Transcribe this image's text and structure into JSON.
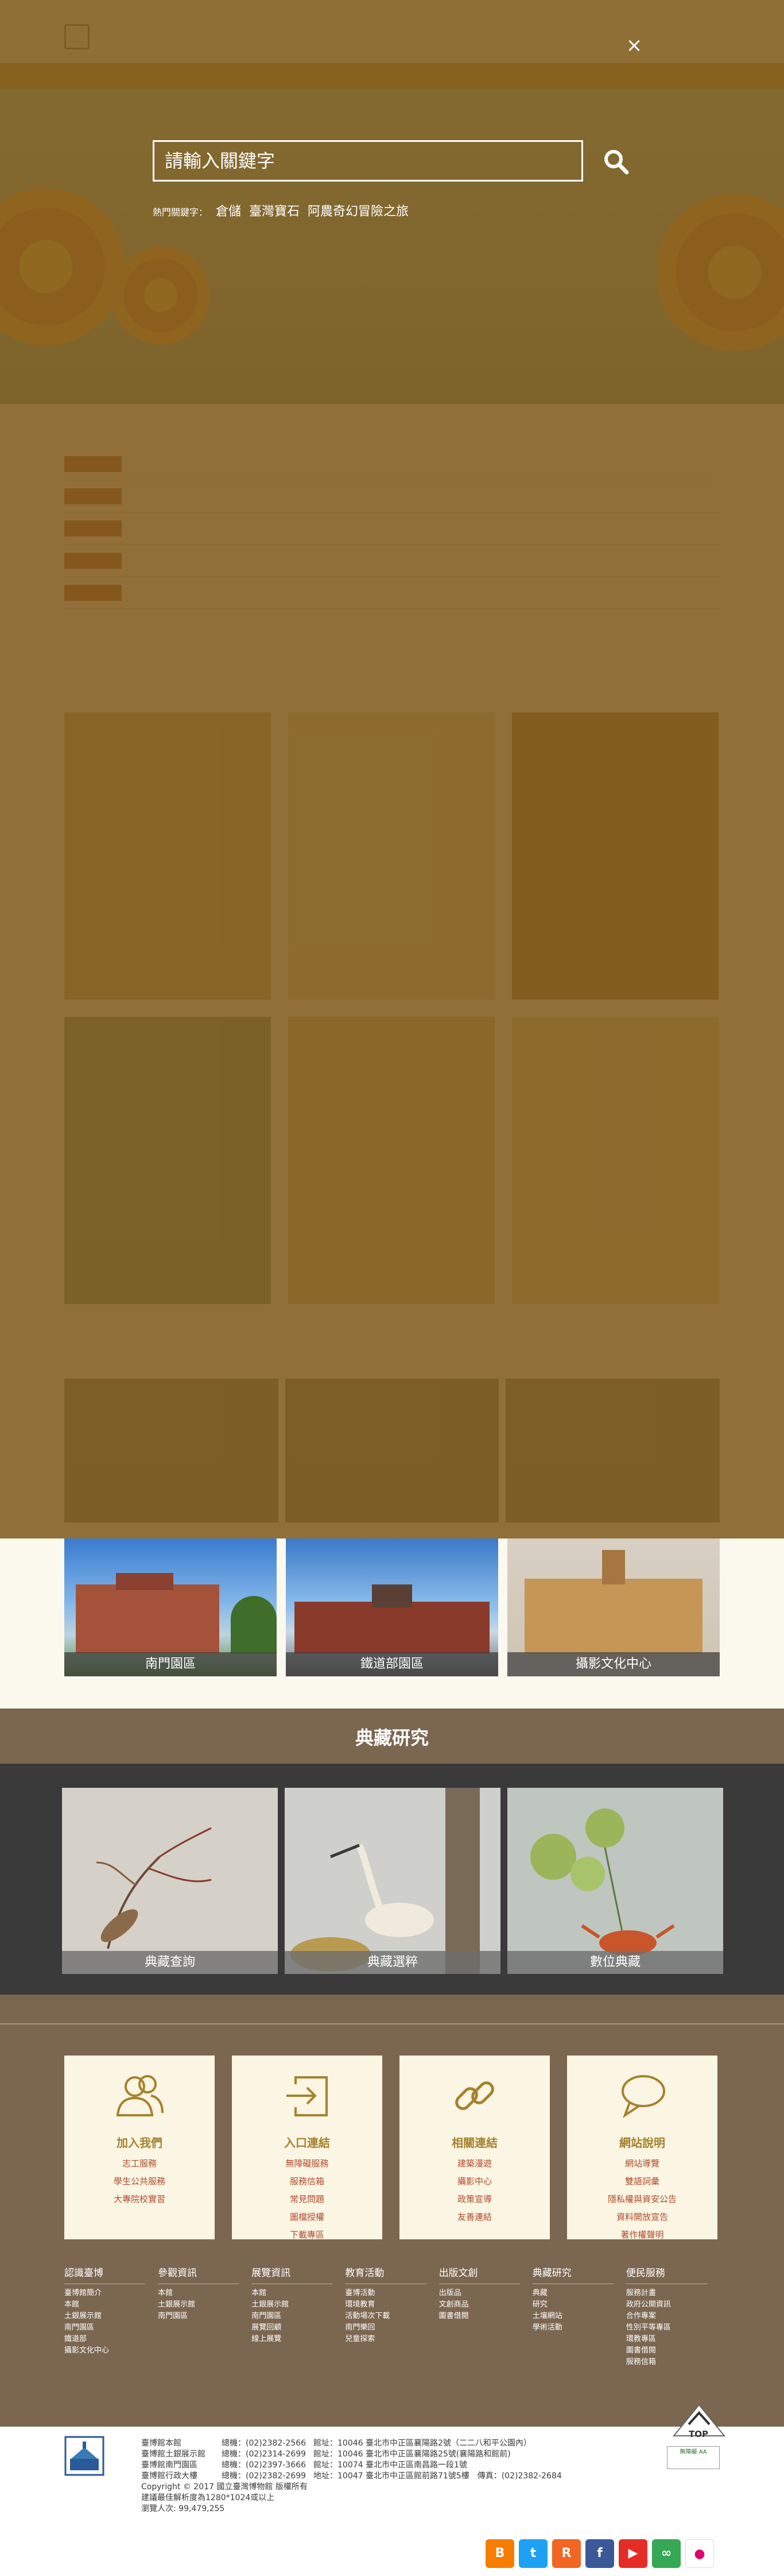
{
  "search": {
    "placeholder": "請輸入關鍵字",
    "hot_label": "熱門關鍵字：",
    "keywords": [
      "倉儲",
      "臺灣寶石",
      "阿農奇幻冒險之旅"
    ],
    "close_symbol": "×"
  },
  "venues": [
    {
      "label": "南門園區"
    },
    {
      "label": "鐵道部園區"
    },
    {
      "label": "攝影文化中心"
    }
  ],
  "collection": {
    "title": "典藏研究",
    "items": [
      {
        "label": "典藏查詢"
      },
      {
        "label": "典藏選粹"
      },
      {
        "label": "數位典藏"
      }
    ]
  },
  "info_boxes": [
    {
      "icon": "people-icon",
      "title": "加入我們",
      "links": [
        "志工服務",
        "學生公共服務",
        "大專院校實習"
      ]
    },
    {
      "icon": "enter-icon",
      "title": "入口連結",
      "links": [
        "無障礙服務",
        "服務信箱",
        "常見問題",
        "圖檔授權",
        "下載專區"
      ]
    },
    {
      "icon": "link-icon",
      "title": "相關連結",
      "links": [
        "建築漫遊",
        "攝影中心",
        "政策宣導",
        "友善連結"
      ]
    },
    {
      "icon": "chat-icon",
      "title": "網站說明",
      "links": [
        "網站導覽",
        "雙語詞彙",
        "隱私權與資安公告",
        "資料開放宣告",
        "著作權聲明"
      ]
    }
  ],
  "sitemap": [
    {
      "head": "認識臺博",
      "items": [
        "臺博館簡介",
        "本館",
        "土銀展示館",
        "南門園區",
        "鐵道部",
        "攝影文化中心"
      ]
    },
    {
      "head": "參觀資訊",
      "items": [
        "本館",
        "土銀展示館",
        "南門園區"
      ]
    },
    {
      "head": "展覽資訊",
      "items": [
        "本館",
        "土銀展示館",
        "南門園區",
        "展覽回顧",
        "線上展覽"
      ]
    },
    {
      "head": "教育活動",
      "items": [
        "臺博活動",
        "環境教育",
        "活動場次下載",
        "南門樂回",
        "兒童探索"
      ]
    },
    {
      "head": "出版文創",
      "items": [
        "出版品",
        "文創商品",
        "圖書借閱"
      ]
    },
    {
      "head": "典藏研究",
      "items": [
        "典藏",
        "研究",
        "土壤網站",
        "學術活動"
      ]
    },
    {
      "head": "便民服務",
      "items": [
        "服務計畫",
        "政府公開資訊",
        "合作專案",
        "性別平等專區",
        "環教專區",
        "圖書借閱",
        "服務信箱"
      ]
    }
  ],
  "footer": {
    "addresses": [
      {
        "name": "臺博館本館",
        "tel": "總機：(02)2382-2566",
        "addr": "館址：10046 臺北市中正區襄陽路2號（二二八和平公園內）"
      },
      {
        "name": "臺博館土銀展示館",
        "tel": "總機：(02)2314-2699",
        "addr": "館址：10046 臺北市中正區襄陽路25號(襄陽路和館前)"
      },
      {
        "name": "臺博館南門園區",
        "tel": "總機：(02)2397-3666",
        "addr": "館址：10074 臺北市中正區南昌路一段1號"
      },
      {
        "name": "臺博館行政大樓",
        "tel": "總機：(02)2382-2699",
        "addr": "地址：10047 臺北市中正區館前路71號5樓　傳真：(02)2382-2684"
      }
    ],
    "copyright": "Copyright © 2017 國立臺灣博物館 版權所有",
    "browser_note": "建議最佳解析度為1280*1024或以上",
    "visits": "瀏覽人次: 99,479,255",
    "top_label": "TOP",
    "accessibility_badge": "無障礙 AA"
  },
  "socials": [
    {
      "name": "blogger",
      "glyph": "B",
      "color": "#f57d00"
    },
    {
      "name": "twitter",
      "glyph": "t",
      "color": "#1da1f2"
    },
    {
      "name": "rss",
      "glyph": "R",
      "color": "#f26522"
    },
    {
      "name": "facebook",
      "glyph": "f",
      "color": "#3b5998"
    },
    {
      "name": "youtube",
      "glyph": "▶",
      "color": "#e52d27"
    },
    {
      "name": "tripadvisor",
      "glyph": "∞",
      "color": "#34a853"
    },
    {
      "name": "flickr",
      "glyph": "●",
      "color": "#ffffff"
    }
  ],
  "colors": {
    "overlay": "#7e5a1a",
    "accent_gold": "#a5822d",
    "link_red": "#b04a2e",
    "band_brown": "#7b6650"
  }
}
